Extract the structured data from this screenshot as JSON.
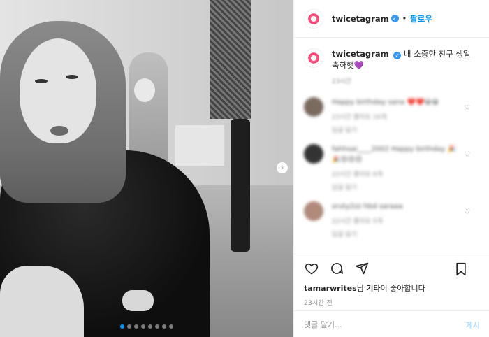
{
  "post": {
    "username": "twicetagram",
    "follow_label": "팔로우",
    "separator": "•",
    "caption_user": "twicetagram",
    "caption_text": "내 소중한 친구 생일 축하햇",
    "caption_emoji": "💜",
    "caption_time": "23시간"
  },
  "comments": [
    {
      "text": "Happy birthday sana ❤️❤️😀😀",
      "meta": "23시간   좋아요 16개",
      "reply": "답글 달기"
    },
    {
      "text": "fahhsai____2002 Happy birthday 🎉🎉😍😍😍",
      "meta": "22시간   좋아요 6개",
      "reply": "답글 달기"
    },
    {
      "text": "sruty2zz hbd saraaa",
      "meta": "22시간   좋아요 5개",
      "reply": "답글 달기"
    }
  ],
  "likes": {
    "user": "tamarwrites",
    "suffix_1": "님",
    "others": "기타",
    "suffix_2": "이 좋아합니다"
  },
  "timestamp": "23시간 전",
  "comment_input": {
    "placeholder": "댓글 달기..."
  },
  "post_button": "게시",
  "icons": {
    "like": "heart-icon",
    "comment": "comment-icon",
    "share": "share-icon",
    "save": "bookmark-icon",
    "verified": "verified-badge-icon",
    "next": "chevron-right-icon"
  },
  "colors": {
    "accent": "#0095f6",
    "verified": "#3897f0",
    "muted": "#8e8e8e",
    "post_disabled": "#b2dffc"
  },
  "carousel": {
    "count": 8,
    "active": 1
  }
}
